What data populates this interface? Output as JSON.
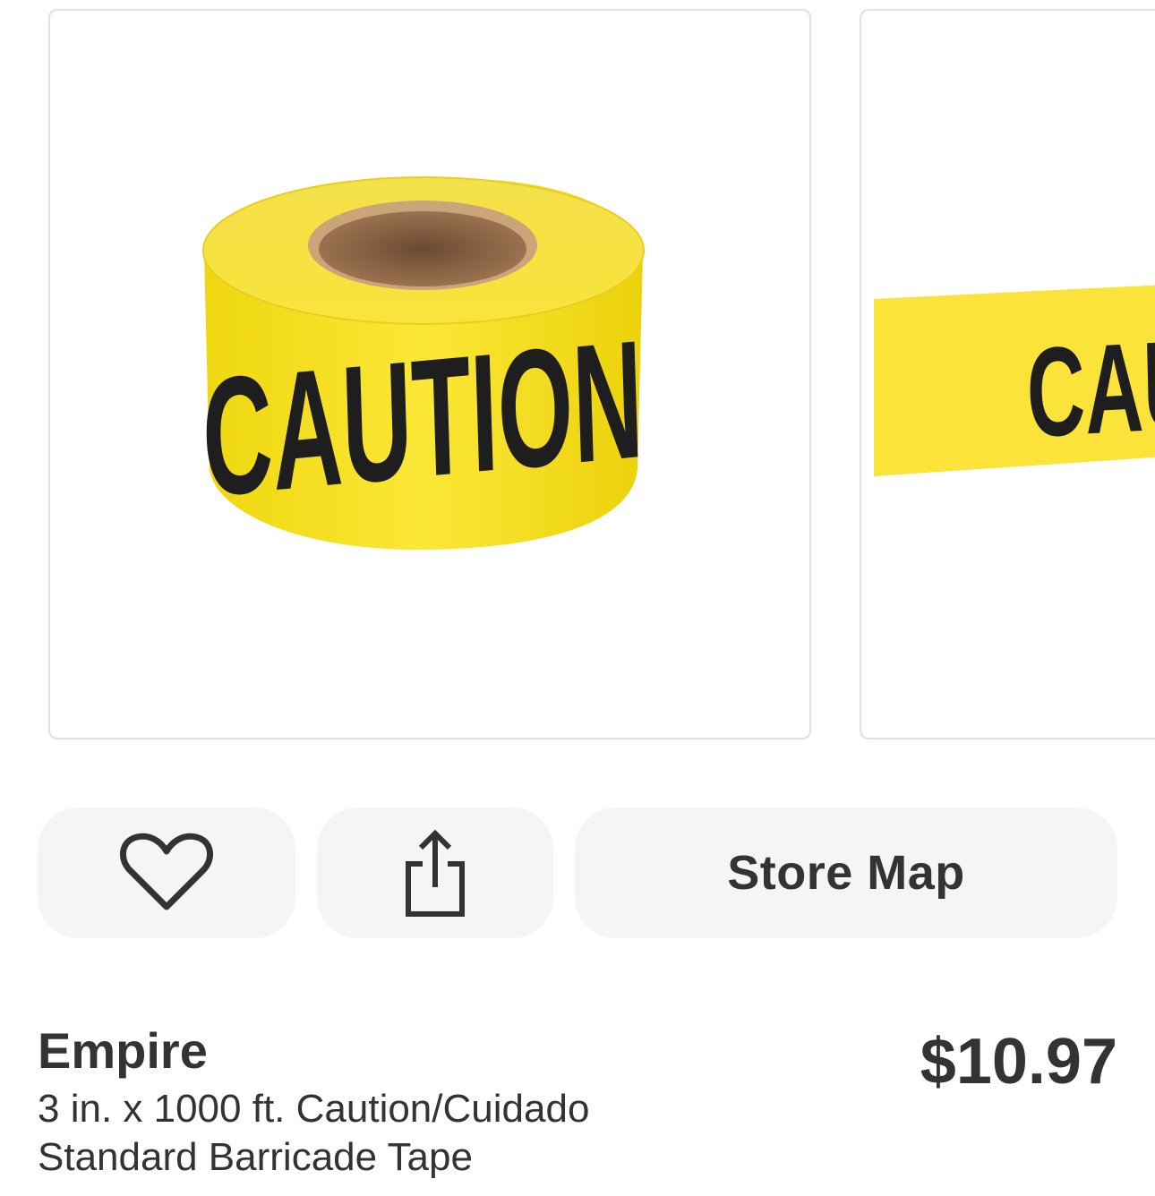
{
  "gallery": {
    "images": [
      {
        "alt": "CAUTION",
        "icon": "caution-tape-roll-image"
      },
      {
        "alt": "CAUTION",
        "icon": "caution-tape-strip-image"
      }
    ]
  },
  "actions": {
    "favorite_icon": "heart-icon",
    "share_icon": "share-icon",
    "store_map_label": "Store Map"
  },
  "product": {
    "brand": "Empire",
    "title": "3 in. x 1000 ft. Caution/Cuidado Standard Barricade Tape",
    "price": "$10.97"
  },
  "colors": {
    "tape_yellow": "#f7e018",
    "tape_text": "#1e1e1e",
    "pill_background": "#f5f5f5",
    "text": "#333333"
  }
}
